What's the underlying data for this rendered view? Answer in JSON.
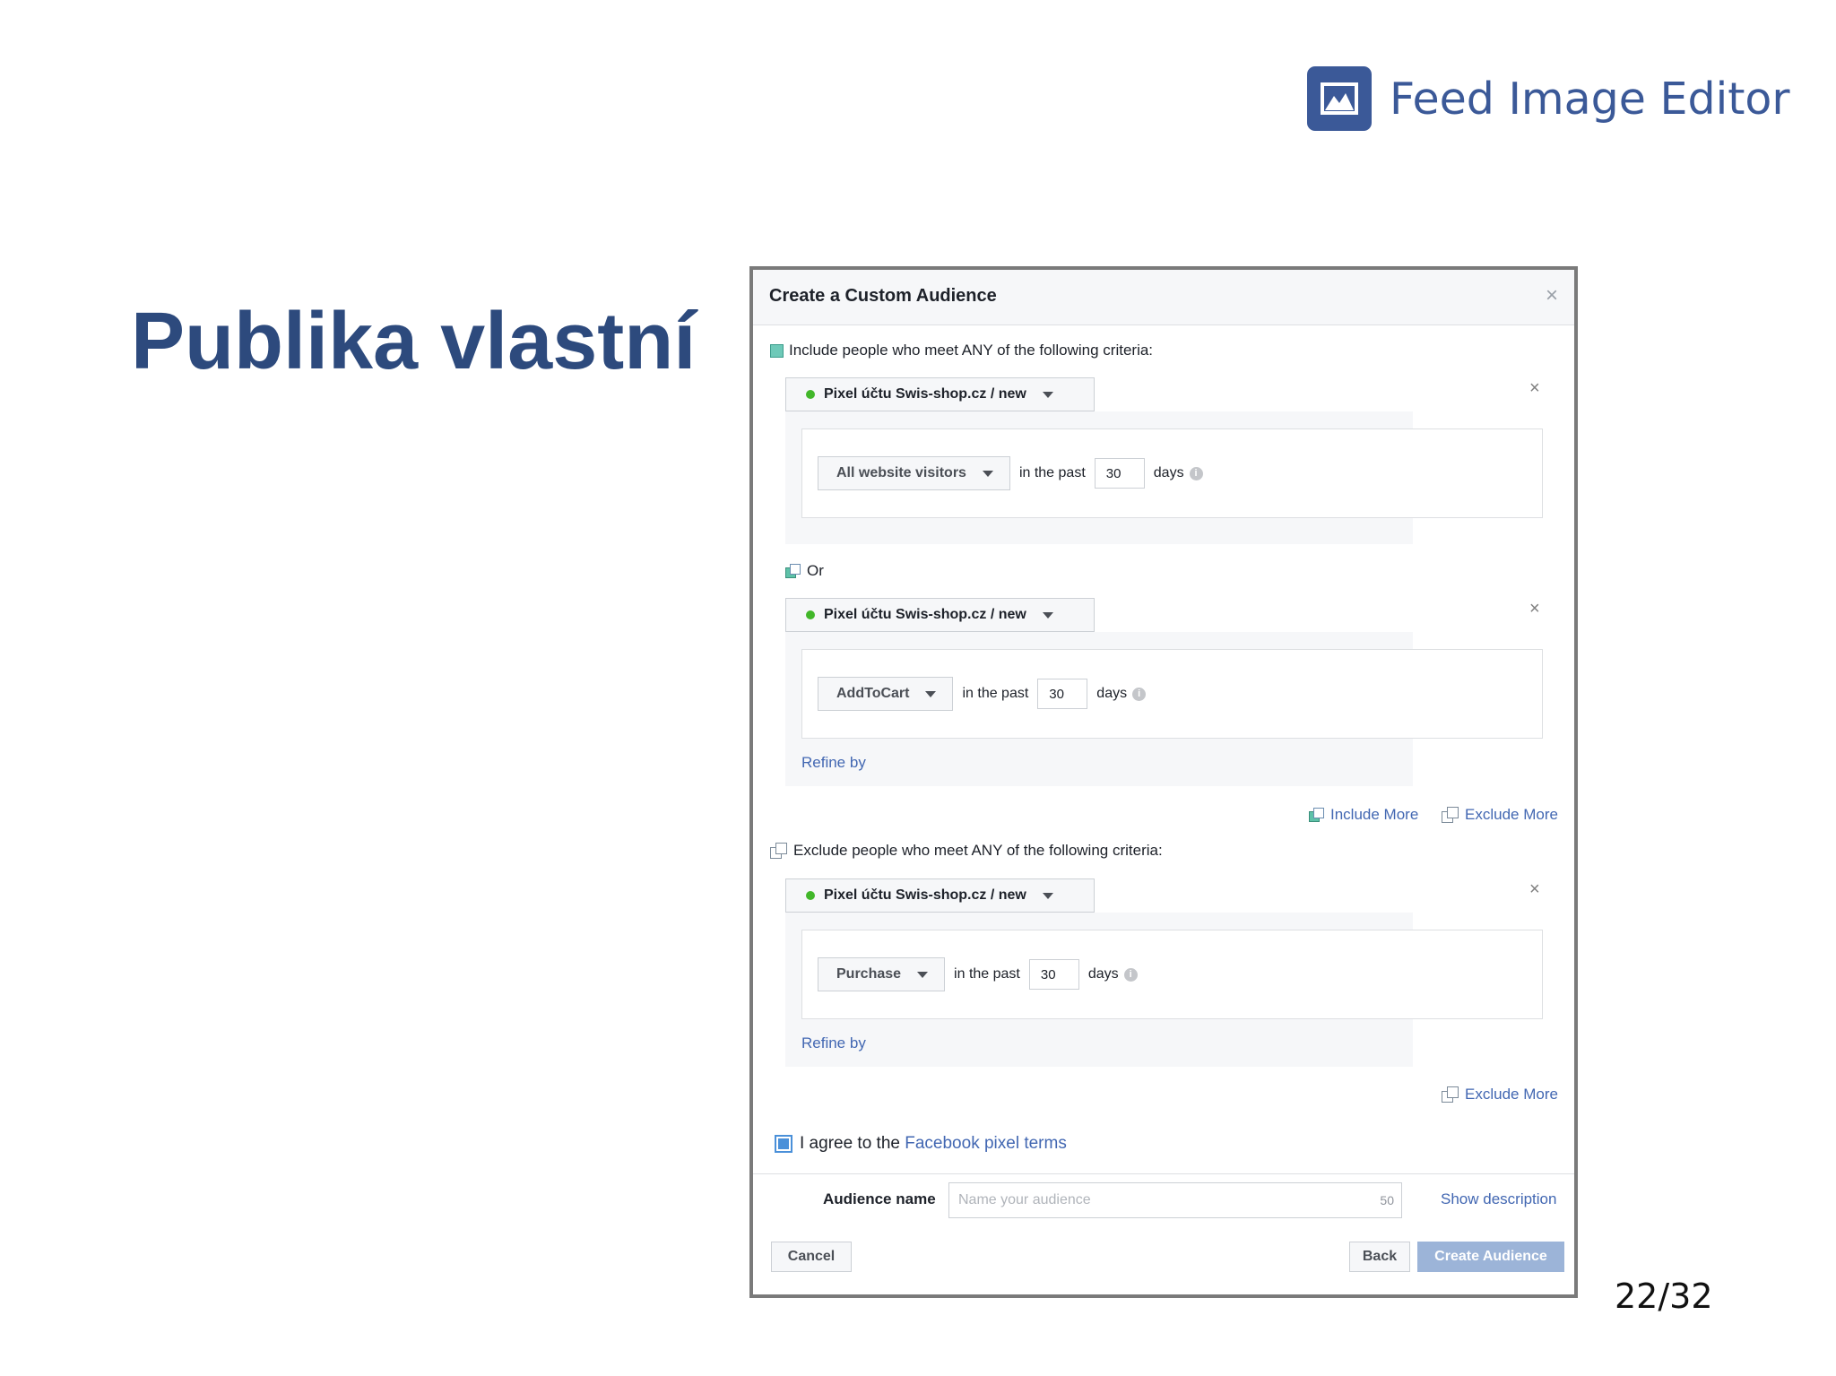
{
  "header": {
    "brand_title": "Feed Image Editor",
    "brand_icon": "image-icon",
    "brand_color": "#3b5998"
  },
  "slide": {
    "title": "Publika vlastní",
    "page_number": "22/32"
  },
  "dialog": {
    "title": "Create a Custom Audience",
    "include_label": "Include people who meet ANY of the following criteria:",
    "or_label": "Or",
    "exclude_label": "Exclude people who meet ANY of the following criteria:",
    "rules": [
      {
        "pixel": "Pixel účtu Swis-shop.cz / new",
        "event": "All website visitors",
        "in_the_past": "in the past",
        "days_value": "30",
        "days_label": "days"
      },
      {
        "pixel": "Pixel účtu Swis-shop.cz / new",
        "event": "AddToCart",
        "in_the_past": "in the past",
        "days_value": "30",
        "days_label": "days",
        "refine": "Refine by"
      },
      {
        "pixel": "Pixel účtu Swis-shop.cz / new",
        "event": "Purchase",
        "in_the_past": "in the past",
        "days_value": "30",
        "days_label": "days",
        "refine": "Refine by"
      }
    ],
    "include_more": "Include More",
    "exclude_more": "Exclude More",
    "agree_prefix": "I agree to the ",
    "agree_link": "Facebook pixel terms",
    "audience_name_label": "Audience name",
    "audience_name_placeholder": "Name your audience",
    "audience_name_limit": "50",
    "show_description": "Show description",
    "cancel": "Cancel",
    "back": "Back",
    "create": "Create Audience",
    "close_symbol": "×",
    "help_symbol": "i"
  }
}
